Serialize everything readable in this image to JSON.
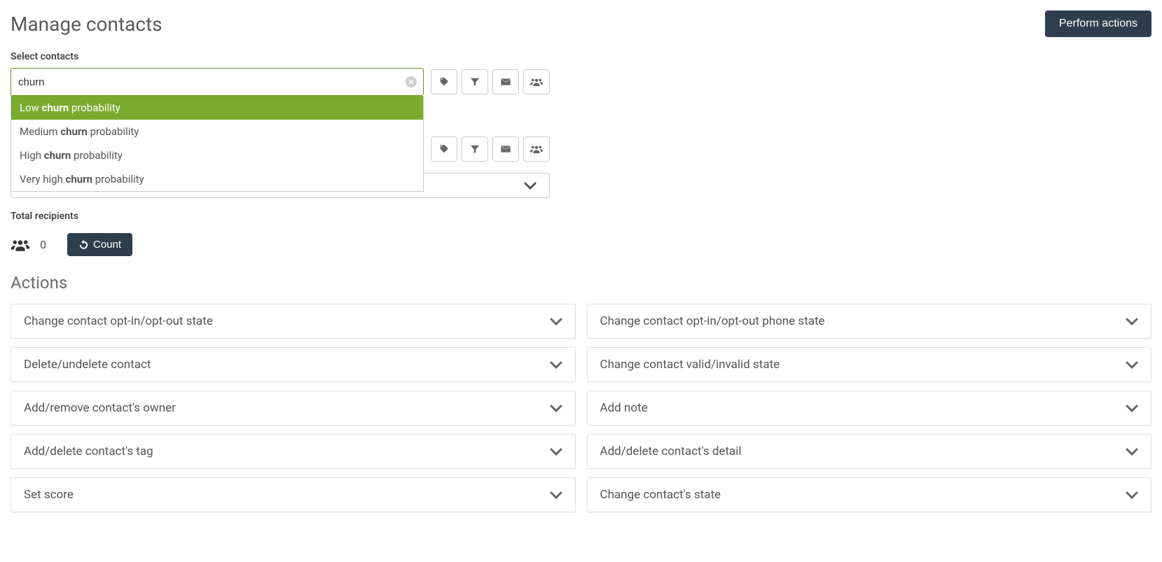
{
  "header": {
    "title": "Manage contacts",
    "perform_button": "Perform actions"
  },
  "select": {
    "label": "Select contacts",
    "query": "churn",
    "options": [
      {
        "pre": "Low ",
        "match": "churn",
        "post": " probability",
        "active": true
      },
      {
        "pre": "Medium ",
        "match": "churn",
        "post": " probability",
        "active": false
      },
      {
        "pre": "High ",
        "match": "churn",
        "post": " probability",
        "active": false
      },
      {
        "pre": "Very high ",
        "match": "churn",
        "post": " probability",
        "active": false
      }
    ]
  },
  "recipients": {
    "label": "Total recipients",
    "count": "0",
    "count_button": "Count"
  },
  "actions": {
    "heading": "Actions",
    "left": [
      "Change contact opt-in/opt-out state",
      "Delete/undelete contact",
      "Add/remove contact's owner",
      "Add/delete contact's tag",
      "Set score"
    ],
    "right": [
      "Change contact opt-in/opt-out phone state",
      "Change contact valid/invalid state",
      "Add note",
      "Add/delete contact's detail",
      "Change contact's state"
    ]
  }
}
